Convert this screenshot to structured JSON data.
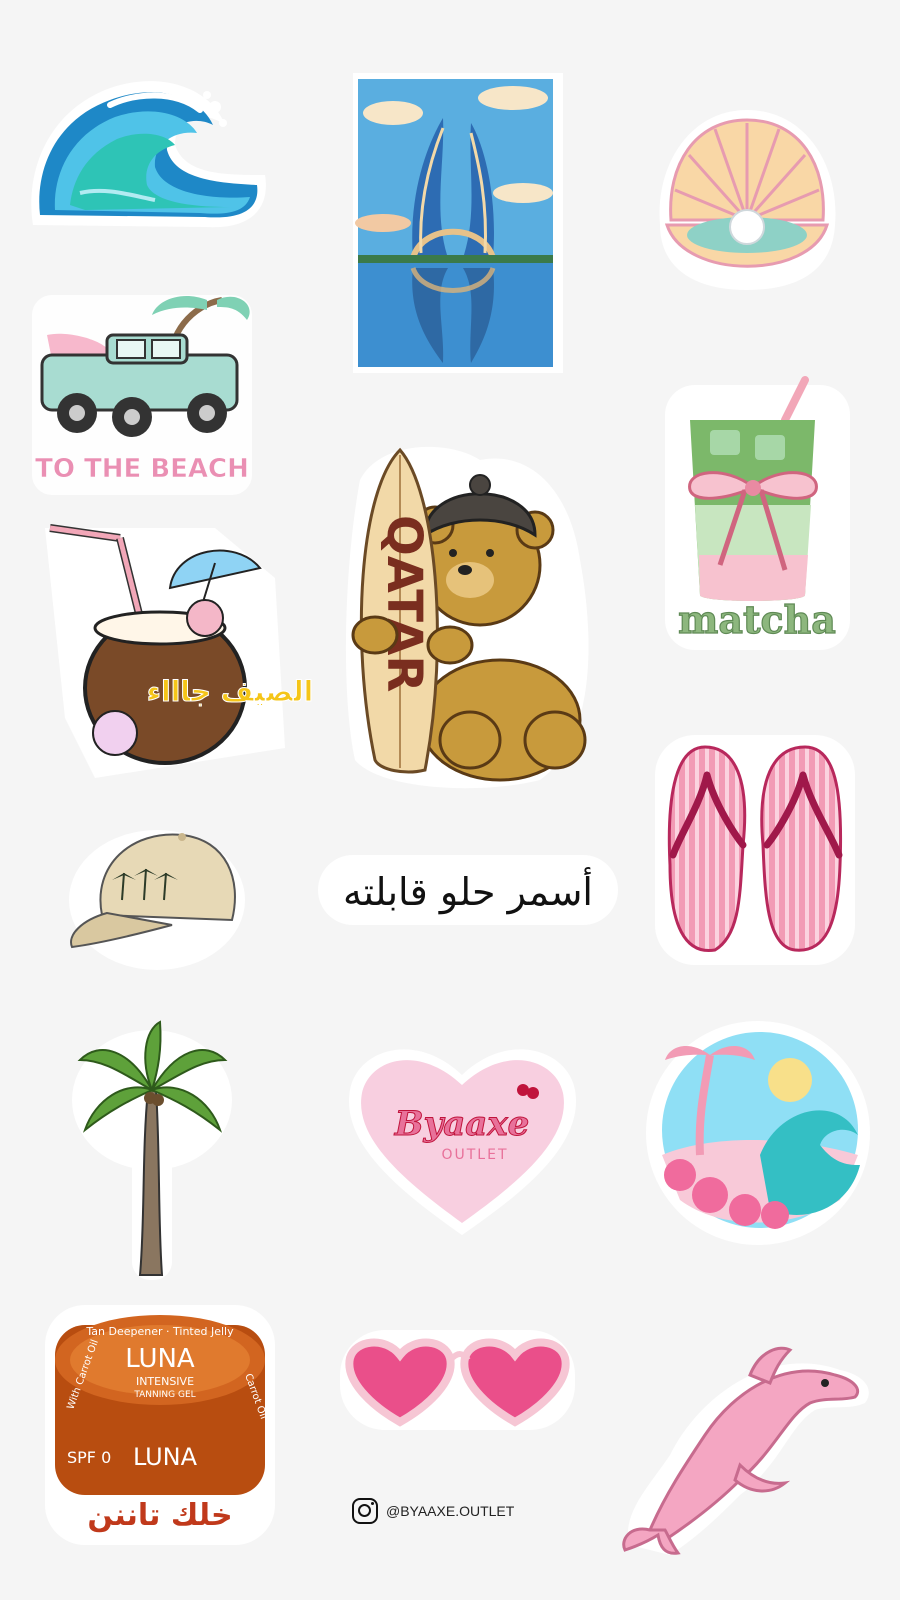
{
  "stickers": {
    "wave": {
      "icon": "wave-icon"
    },
    "tower": {
      "icon": "lusail-towers-icon"
    },
    "shell": {
      "icon": "pearl-shell-icon"
    },
    "truck": {
      "icon": "beach-truck-icon",
      "text": "TO THE BEACH"
    },
    "matcha": {
      "icon": "matcha-drink-icon",
      "text": "matcha"
    },
    "coconut": {
      "icon": "coconut-drink-icon",
      "text": "الصيف جاااء"
    },
    "bear": {
      "icon": "teddy-bear-surfboard-icon",
      "text": "QATAR"
    },
    "flipflops": {
      "icon": "flip-flops-icon"
    },
    "cap": {
      "icon": "palm-cap-icon"
    },
    "arabic_phrase": {
      "text": "أسمر حلو قابلته"
    },
    "palm": {
      "icon": "palm-tree-icon"
    },
    "heart_logo": {
      "icon": "heart-logo-icon",
      "brand": "Byaaxe",
      "sub": "OUTLET"
    },
    "beach_circle": {
      "icon": "beach-scene-icon"
    },
    "luna": {
      "icon": "tanning-gel-icon",
      "top_text": "Tan Deepener · Tinted Jelly",
      "brand": "LUNA",
      "line1": "INTENSIVE",
      "line2": "TANNING GEL",
      "side_left": "With Carrot Oil",
      "side_right": "Carrot Oil",
      "spf": "SPF 0",
      "text": "خلك تاننن"
    },
    "sunglasses": {
      "icon": "heart-sunglasses-icon"
    },
    "dolphin": {
      "icon": "pink-dolphin-icon"
    }
  },
  "footer": {
    "icon": "instagram-icon",
    "handle": "@BYAAXE.OUTLET"
  },
  "colors": {
    "background": "#f5f5f5",
    "pink": "#e8719a",
    "teal": "#3ab7c8"
  }
}
